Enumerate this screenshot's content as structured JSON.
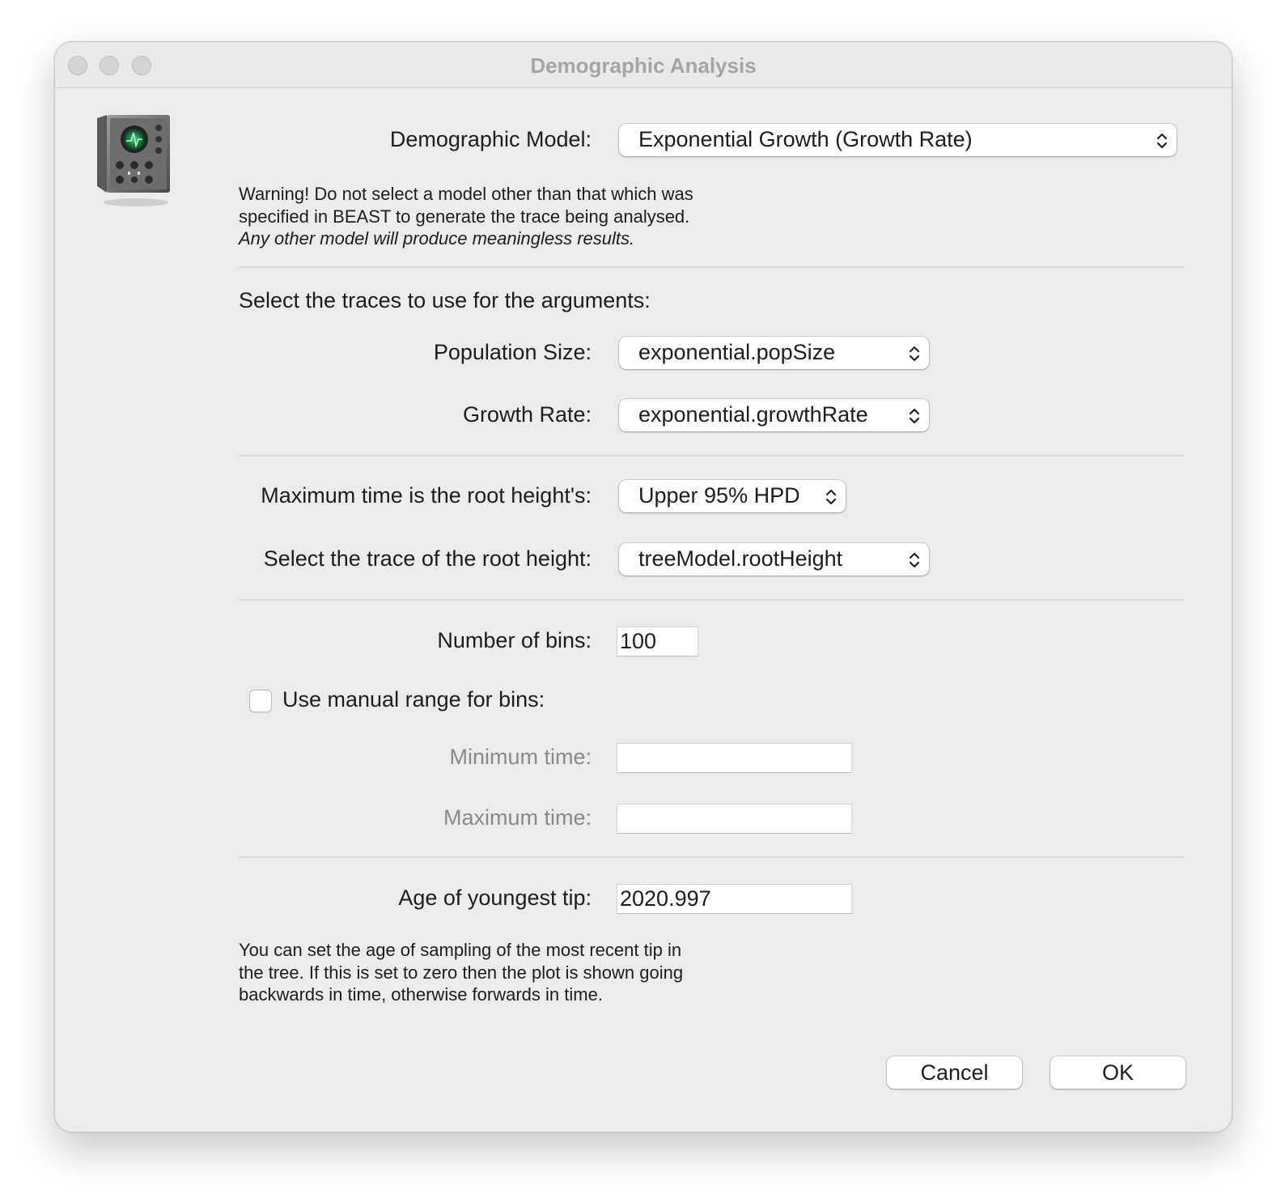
{
  "window": {
    "title": "Demographic Analysis",
    "app_icon": "oscilloscope-icon"
  },
  "model": {
    "label": "Demographic Model:",
    "value": "Exponential Growth (Growth Rate)",
    "warning_lines": [
      "Warning! Do not select a model other than that which was",
      "specified in BEAST to generate the trace being analysed."
    ],
    "warning_italic": "Any other model will produce meaningless results."
  },
  "traces": {
    "heading": "Select the traces to use for the arguments:",
    "pop_size_label": "Population Size:",
    "pop_size_value": "exponential.popSize",
    "growth_rate_label": "Growth Rate:",
    "growth_rate_value": "exponential.growthRate"
  },
  "root": {
    "max_time_label": "Maximum time is the root height's:",
    "max_time_value": "Upper 95% HPD",
    "trace_label": "Select the trace of the root height:",
    "trace_value": "treeModel.rootHeight"
  },
  "bins": {
    "number_label": "Number of bins:",
    "number_value": "100",
    "manual_range_label": "Use manual range for bins:",
    "manual_range_checked": false,
    "min_time_label": "Minimum time:",
    "min_time_value": "",
    "max_time_label": "Maximum time:",
    "max_time_value": ""
  },
  "tip": {
    "age_label": "Age of youngest tip:",
    "age_value": "2020.997",
    "help_lines": [
      "You can set the age of sampling of the most recent tip in",
      "the tree. If this is set to zero then the plot is shown going",
      "backwards in time, otherwise forwards in time."
    ]
  },
  "buttons": {
    "cancel": "Cancel",
    "ok": "OK"
  }
}
